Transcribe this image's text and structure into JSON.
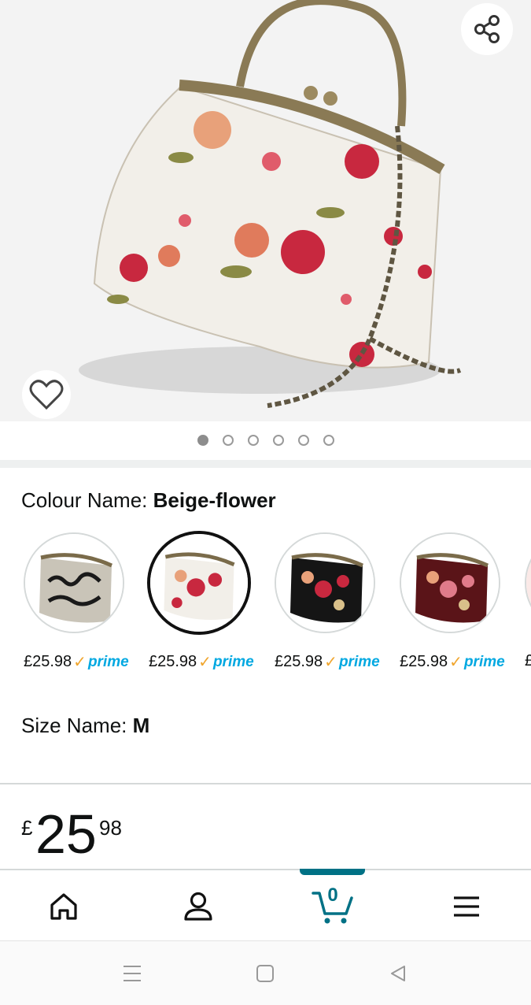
{
  "product": {
    "image_alt": "Floral kiss-lock handbag with chain strap",
    "carousel": {
      "total": 6,
      "active": 0
    },
    "colour_label": "Colour Name:",
    "colour_value": "Beige-flower",
    "swatches": [
      {
        "name": "black-lace",
        "price": "£25.98",
        "badge": "prime",
        "selected": false
      },
      {
        "name": "beige-flower",
        "price": "£25.98",
        "badge": "prime",
        "selected": true
      },
      {
        "name": "black-flower",
        "price": "£25.98",
        "badge": "prime",
        "selected": false
      },
      {
        "name": "wine-flower",
        "price": "£25.98",
        "badge": "prime",
        "selected": false
      },
      {
        "name": "partial",
        "price": "£",
        "badge": "",
        "selected": false
      }
    ],
    "size_label": "Size Name:",
    "size_value": "M",
    "price": {
      "currency": "£",
      "whole": "25",
      "fraction": "98"
    }
  },
  "icons": {
    "share": "share-icon",
    "wishlist": "heart-icon"
  },
  "nav": {
    "items": [
      {
        "name": "home",
        "icon": "home-icon"
      },
      {
        "name": "account",
        "icon": "person-icon"
      },
      {
        "name": "cart",
        "icon": "cart-icon",
        "count": "0",
        "active": true
      },
      {
        "name": "menu",
        "icon": "menu-icon"
      }
    ]
  },
  "system_nav": [
    "recents-icon",
    "home-square-icon",
    "back-icon"
  ],
  "colors": {
    "accent": "#007185",
    "prime_blue": "#00a8e1",
    "prime_check": "#f0a52d"
  }
}
